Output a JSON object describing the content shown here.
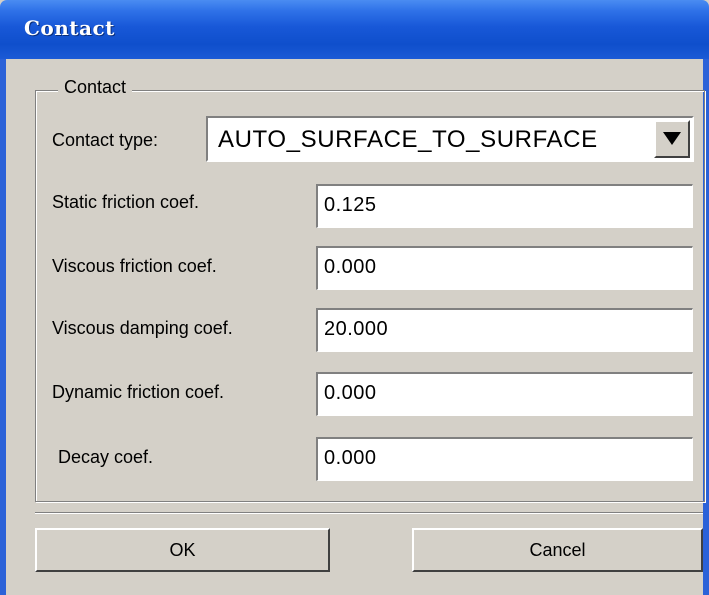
{
  "window": {
    "title": "Contact"
  },
  "group": {
    "legend": "Contact"
  },
  "contact_type": {
    "label": "Contact type:",
    "value": "AUTO_SURFACE_TO_SURFACE"
  },
  "fields": [
    {
      "label": "Static friction coef.",
      "value": "0.125"
    },
    {
      "label": "Viscous friction coef.",
      "value": "0.000"
    },
    {
      "label": "Viscous damping coef.",
      "value": "20.000"
    },
    {
      "label": "Dynamic friction coef.",
      "value": "0.000"
    },
    {
      "label": "Decay coef.",
      "value": "0.000"
    }
  ],
  "buttons": {
    "ok": "OK",
    "cancel": "Cancel"
  },
  "colors": {
    "titlebar": "#0f4fcc",
    "dialog_bg": "#d4d0c8"
  },
  "icons": {
    "dropdown": "triangle-down"
  }
}
